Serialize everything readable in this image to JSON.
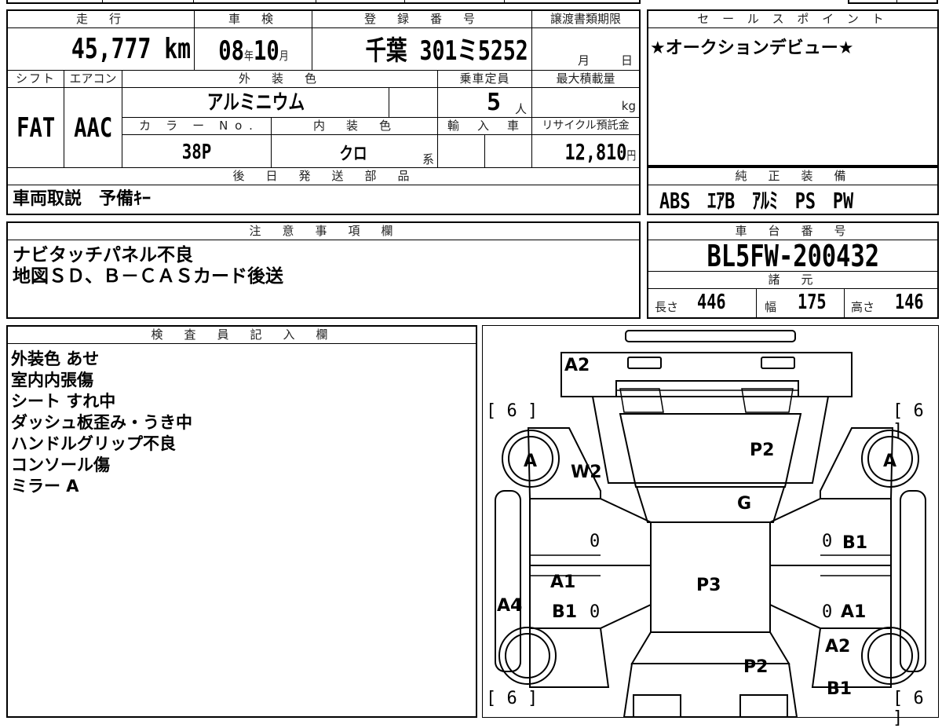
{
  "top_table": {
    "mileage_label": "走　行",
    "mileage": "45,777",
    "mileage_unit": "km",
    "inspection_label": "車　検",
    "inspection_year": "08",
    "year_unit": "年",
    "inspection_month": "10",
    "month_unit": "月",
    "registration_label": "登　録　番　号",
    "registration_region": "千葉",
    "registration_number": "301ミ5252",
    "transfer_label": "譲渡書類期限",
    "transfer_month_unit": "月",
    "transfer_day_unit": "日",
    "shift_label": "シフト",
    "shift": "FAT",
    "aircon_label": "エアコン",
    "aircon": "AAC",
    "exterior_color_label": "外　装　色",
    "exterior_color": "アルミニウム",
    "capacity_label": "乗車定員",
    "capacity": "5",
    "capacity_unit": "人",
    "max_load_label": "最大積載量",
    "max_load_unit": "kg",
    "color_no_label": "カ　ラ　ー　N o .",
    "color_no": "38P",
    "interior_color_label": "内　装　色",
    "interior_color": "クロ",
    "interior_suffix": "系",
    "import_label": "輸　入　車",
    "recycle_label": "リサイクル預託金",
    "recycle_fee": "12,810",
    "yen_unit": "円",
    "later_parts_label": "後　日　発　送　部　品",
    "later_parts": "車両取説　予備ｷｰ"
  },
  "sales_point": {
    "label": "セ ー ル ス ポ イ ン ト",
    "text": "★オークションデビュー★"
  },
  "genuine_equipment": {
    "label": "純　正　装　備",
    "text": "ABS　ｴｱB　ｱﾙﾐ　PS　PW"
  },
  "caution": {
    "label": "注　意　事　項　欄",
    "lines": [
      "ナビタッチパネル不良",
      "地図ＳＤ、Ｂ－ＣＡＳカード後送"
    ]
  },
  "chassis": {
    "label": "車　台　番　号",
    "number": "BL5FW-200432",
    "specs_label": "諸　元",
    "length_label": "長さ",
    "length": "446",
    "width_label": "幅",
    "width": "175",
    "height_label": "高さ",
    "height": "146"
  },
  "inspector": {
    "label": "検　査　員　記　入　欄",
    "lines": [
      "外装色 あせ",
      "室内内張傷",
      "シート すれ中",
      "ダッシュ板歪み・うき中",
      "ハンドルグリップ不良",
      "コンソール傷",
      "ミラー A"
    ]
  },
  "diagram": {
    "tire_depth": "6",
    "marks": {
      "a2_top": "A2",
      "tire_left": "A",
      "tire_right": "A",
      "w2": "W2",
      "p2_hood": "P2",
      "g": "G",
      "b1_right_front": "B1",
      "zero1": "0",
      "zero2": "0",
      "zero3": "0",
      "zero4": "0",
      "a1_left": "A1",
      "b1_left": "B1",
      "a4": "A4",
      "p3": "P3",
      "a1_right": "A1",
      "a2_right": "A2",
      "p2_trunk": "P2",
      "b1_right_rear": "B1"
    }
  }
}
